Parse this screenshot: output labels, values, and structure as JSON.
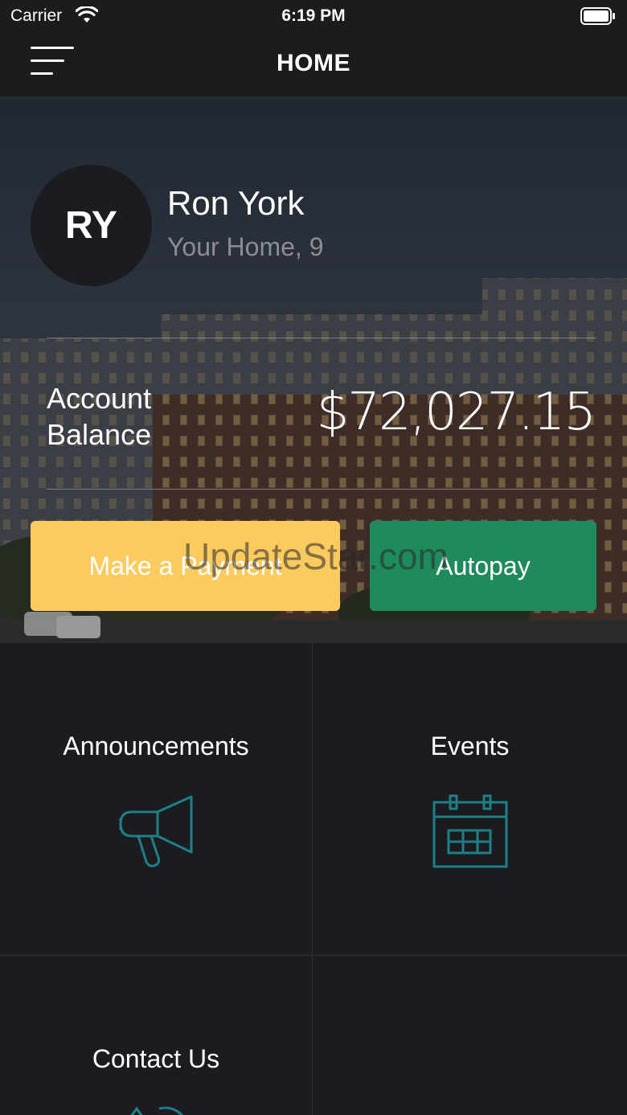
{
  "status_bar": {
    "carrier": "Carrier",
    "time": "6:19 PM"
  },
  "nav": {
    "title": "HOME",
    "menu_icon": "hamburger-icon"
  },
  "profile": {
    "initials": "RY",
    "name": "Ron York",
    "unit": "Your Home, 9"
  },
  "balance": {
    "label": "Account Balance",
    "value": "$72,027.15"
  },
  "actions": {
    "pay_label": "Make a Payment",
    "autopay_label": "Autopay"
  },
  "watermark": "UpdateStar.com",
  "tiles": [
    {
      "label": "Announcements",
      "icon": "megaphone-icon"
    },
    {
      "label": "Events",
      "icon": "calendar-icon"
    },
    {
      "label": "Contact Us",
      "icon": "contact-icon"
    }
  ],
  "colors": {
    "pay": "#fccb5f",
    "autopay": "#1f8a5c",
    "icon_teal": "#1f7f86",
    "background": "#1a1c20"
  }
}
